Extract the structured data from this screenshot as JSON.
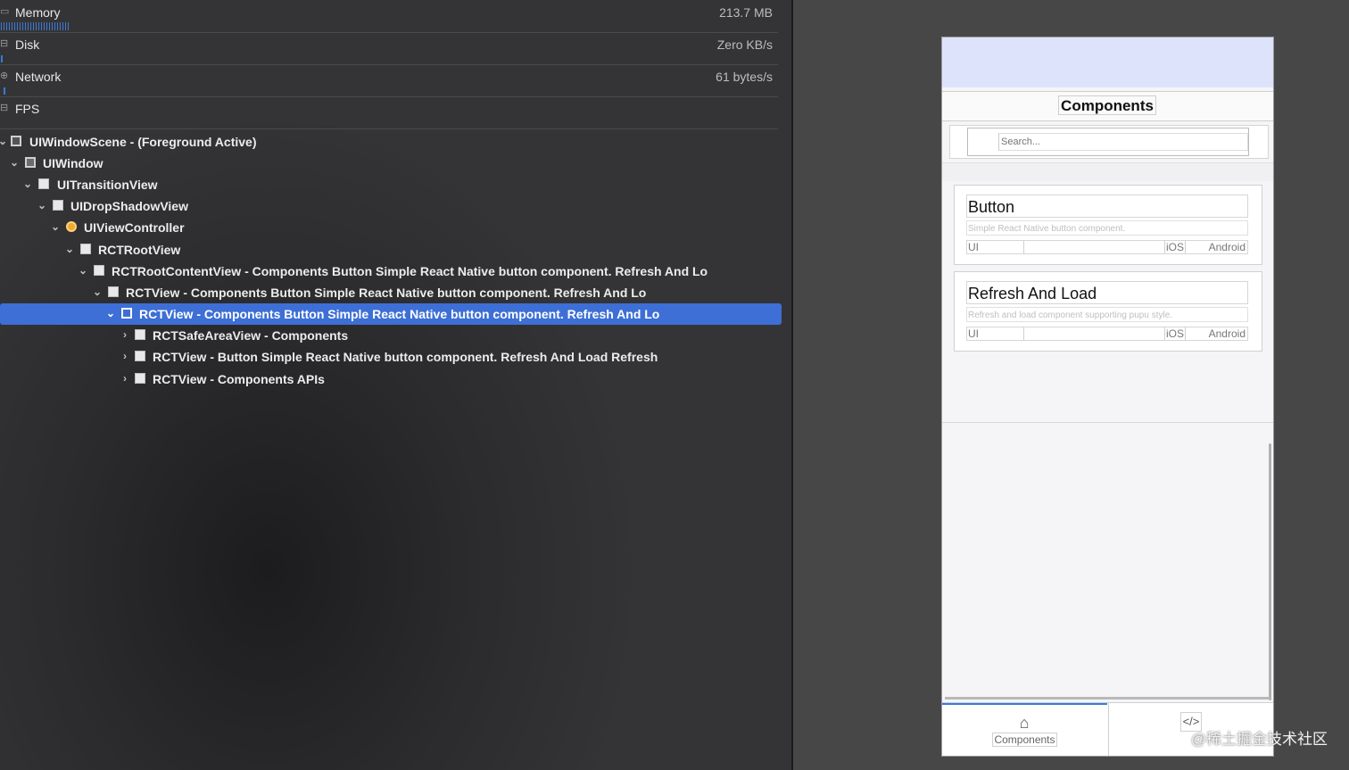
{
  "debug_gauges": [
    {
      "icon": "memory-icon",
      "label": "Memory",
      "value": "213.7 MB"
    },
    {
      "icon": "disk-icon",
      "label": "Disk",
      "value": "Zero KB/s"
    },
    {
      "icon": "network-icon",
      "label": "Network",
      "value": "61 bytes/s"
    },
    {
      "icon": "fps-icon",
      "label": "FPS",
      "value": ""
    }
  ],
  "view_tree": [
    {
      "label": "UIWindowScene - (Foreground Active)",
      "expanded": true
    },
    {
      "label": "UIWindow",
      "expanded": true
    },
    {
      "label": "UITransitionView",
      "expanded": true
    },
    {
      "label": "UIDropShadowView",
      "expanded": true
    },
    {
      "label": "UIViewController",
      "expanded": true
    },
    {
      "label": "RCTRootView",
      "expanded": true
    },
    {
      "label": "RCTRootContentView - Components Button Simple React Native button component. Refresh And Lo",
      "expanded": true
    },
    {
      "label": "RCTView - Components Button Simple React Native button component. Refresh And Lo",
      "expanded": true
    },
    {
      "label": "RCTView - Components Button Simple React Native button component. Refresh And Lo",
      "expanded": true,
      "selected": true
    },
    {
      "label": "RCTSafeAreaView - Components",
      "expanded": false
    },
    {
      "label": "RCTView - Button Simple React Native button component. Refresh And Load Refresh",
      "expanded": false
    },
    {
      "label": "RCTView - Components APIs",
      "expanded": false
    }
  ],
  "phone": {
    "title": "Components",
    "search_placeholder": "Search...",
    "cards": [
      {
        "title": "Button",
        "description": "Simple React Native button component.",
        "tag_ui": "UI",
        "tag_ios": "iOS",
        "tag_android": "Android"
      },
      {
        "title": "Refresh And Load",
        "description": "Refresh and load component supporting pupu style.",
        "tag_ui": "UI",
        "tag_ios": "iOS",
        "tag_android": "Android"
      }
    ],
    "tabs": [
      {
        "label": "Components",
        "icon": "home-icon",
        "active": true
      },
      {
        "label": "",
        "icon": "code-icon",
        "active": false
      }
    ]
  },
  "watermark": "@稀土掘金技术社区",
  "colors": {
    "selection": "#3d6fd6",
    "gauge_bar": "#3a7bd5",
    "status_bar": "#dde3fb"
  }
}
